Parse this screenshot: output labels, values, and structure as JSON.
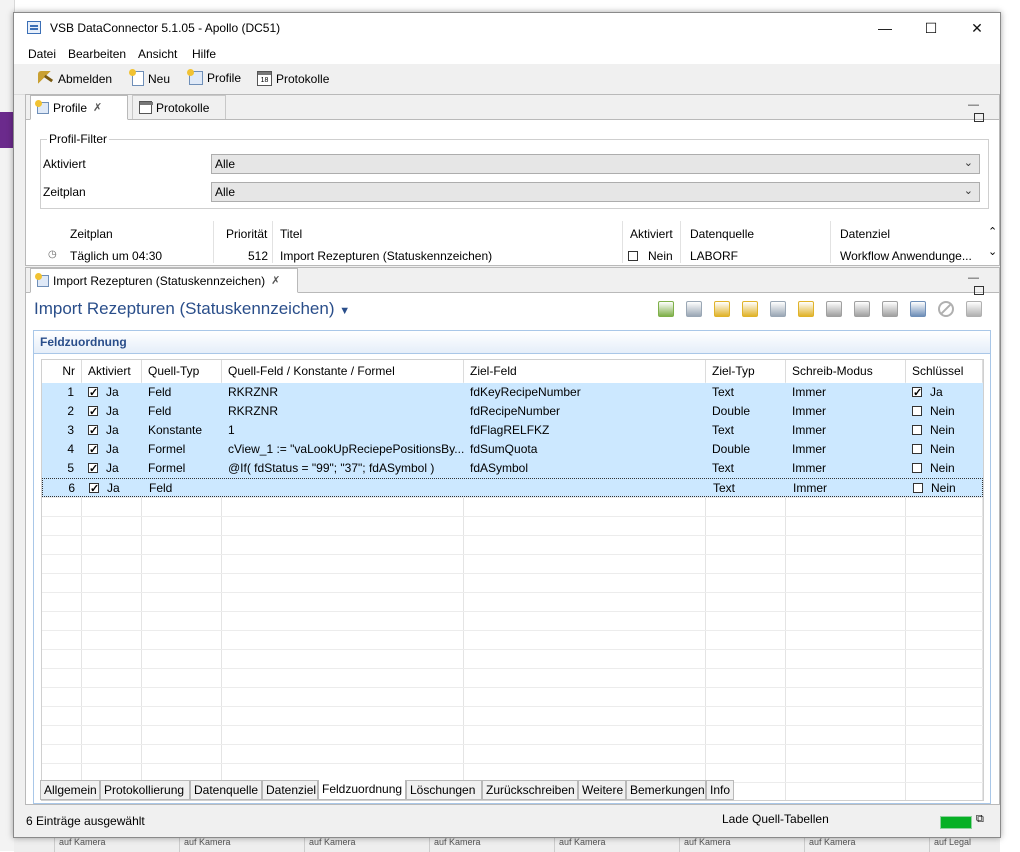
{
  "window": {
    "title": "VSB DataConnector 5.1.05 - Apollo (DC51)",
    "minimize": "—",
    "maximize": "☐",
    "close": "✕"
  },
  "menu": [
    "Datei",
    "Bearbeiten",
    "Ansicht",
    "Hilfe"
  ],
  "toolbar": {
    "logout": "Abmelden",
    "new": "Neu",
    "profile": "Profile",
    "logs": "Protokolle"
  },
  "profiles_view": {
    "tabs": [
      "Profile",
      "Protokolle"
    ],
    "filter": {
      "legend": "Profil-Filter",
      "activated_label": "Aktiviert",
      "activated_value": "Alle",
      "schedule_label": "Zeitplan",
      "schedule_value": "Alle"
    },
    "table": {
      "headers": [
        "Zeitplan",
        "Priorität",
        "Titel",
        "Aktiviert",
        "Datenquelle",
        "Datenziel"
      ],
      "row": {
        "schedule": "Täglich um 04:30",
        "priority": "512",
        "title": "Import Rezepturen (Statuskennzeichen)",
        "activated": "Nein",
        "source": "LABORF",
        "target": "Workflow Anwendunge..."
      }
    }
  },
  "editor": {
    "tab": "Import Rezepturen (Statuskennzeichen)",
    "title": "Import Rezepturen (Statuskennzeichen)",
    "section": "Feldzuordnung",
    "headers": [
      "Nr",
      "Aktiviert",
      "Quell-Typ",
      "Quell-Feld / Konstante / Formel",
      "Ziel-Feld",
      "Ziel-Typ",
      "Schreib-Modus",
      "Schlüssel"
    ],
    "rows": [
      {
        "nr": "1",
        "act": "Ja",
        "qtyp": "Feld",
        "qfeld": "RKRZNR",
        "ziel": "fdKeyRecipeNumber",
        "ztyp": "Text",
        "mode": "Immer",
        "key": "Ja",
        "key_on": true
      },
      {
        "nr": "2",
        "act": "Ja",
        "qtyp": "Feld",
        "qfeld": "RKRZNR",
        "ziel": "fdRecipeNumber",
        "ztyp": "Double",
        "mode": "Immer",
        "key": "Nein",
        "key_on": false
      },
      {
        "nr": "3",
        "act": "Ja",
        "qtyp": "Konstante",
        "qfeld": "1",
        "ziel": "fdFlagRELFKZ",
        "ztyp": "Text",
        "mode": "Immer",
        "key": "Nein",
        "key_on": false
      },
      {
        "nr": "4",
        "act": "Ja",
        "qtyp": "Formel",
        "qfeld": "cView_1 := \"vaLookUpReciepePositionsBy...",
        "ziel": "fdSumQuota",
        "ztyp": "Double",
        "mode": "Immer",
        "key": "Nein",
        "key_on": false
      },
      {
        "nr": "5",
        "act": "Ja",
        "qtyp": "Formel",
        "qfeld": "@If( fdStatus = \"99\"; \"37\"; fdASymbol )",
        "ziel": "fdASymbol",
        "ztyp": "Text",
        "mode": "Immer",
        "key": "Nein",
        "key_on": false
      },
      {
        "nr": "6",
        "act": "Ja",
        "qtyp": "Feld",
        "qfeld": "",
        "ziel": "",
        "ztyp": "Text",
        "mode": "Immer",
        "key": "Nein",
        "key_on": false
      }
    ],
    "bottom_tabs": [
      "Allgemein",
      "Protokollierung",
      "Datenquelle",
      "Datenziel",
      "Feldzuordnung",
      "Löschungen",
      "Zurückschreiben",
      "Weitere",
      "Bemerkungen",
      "Info"
    ],
    "active_bottom_tab": "Feldzuordnung"
  },
  "status": {
    "left": "6 Einträge ausgewählt",
    "right": "Lade Quell-Tabellen"
  },
  "background": {
    "bottom_cells": [
      "auf Kamera",
      "auf Kamera",
      "auf Kamera",
      "auf Kamera",
      "auf Kamera",
      "auf Kamera",
      "auf Kamera",
      "auf Legal"
    ]
  },
  "colors": {
    "selection": "#cce8ff",
    "accent_title": "#2a4e8a",
    "progress": "#06b025"
  }
}
